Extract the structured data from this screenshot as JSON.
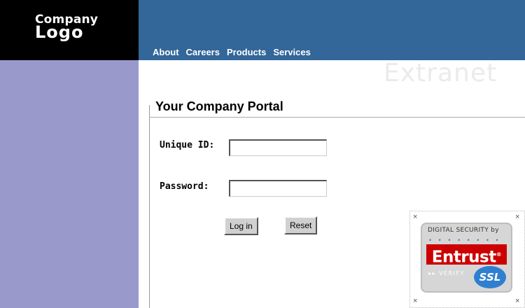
{
  "logo": {
    "line1": "Company",
    "line2": "Logo"
  },
  "nav": {
    "items": [
      "About",
      "Careers",
      "Products",
      "Services"
    ]
  },
  "watermark": "Extranet",
  "portal": {
    "title": "Your Company Portal"
  },
  "form": {
    "unique_id_label": "Unique ID:",
    "unique_id_value": "",
    "password_label": "Password:",
    "password_value": "",
    "login_label": "Log in",
    "reset_label": "Reset"
  },
  "seal": {
    "top_text": "DIGITAL SECURITY by",
    "dots": "• • • • • • • •",
    "brand": "Entrust",
    "registered": "®",
    "verify_text": "▸▸ VERIFY",
    "ssl_text": "SSL",
    "close_glyph": "×"
  },
  "colors": {
    "header": "#336699",
    "sidebar": "#9999cc",
    "logo_bg": "#000000",
    "seal_brand": "#cc0000"
  }
}
